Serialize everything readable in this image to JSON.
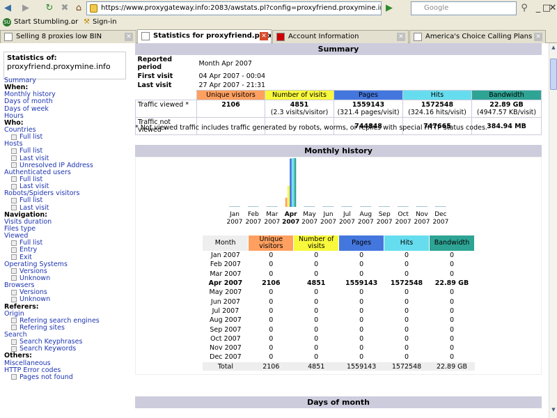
{
  "browser": {
    "url": "https://www.proxygateway.info:2083/awstats.pl?config=proxyfriend.proxymine.info&lang=en",
    "search_placeholder": "Google",
    "bookmarks": [
      "Start Stumbling...",
      "or",
      "Sign-in"
    ],
    "tabs": [
      "Selling 8 proxies low BIN",
      "Statistics for proxyfriend.proxy...",
      "Account Information",
      "America's Choice Calling Plans"
    ]
  },
  "sidebar": {
    "title": "Statistics of:",
    "domain": "proxyfriend.proxymine.info",
    "items": [
      {
        "t": "lk",
        "label": "Summary"
      },
      {
        "t": "h",
        "label": "When:"
      },
      {
        "t": "lk",
        "label": "Monthly history"
      },
      {
        "t": "lk",
        "label": "Days of month"
      },
      {
        "t": "lk",
        "label": "Days of week"
      },
      {
        "t": "lk",
        "label": "Hours"
      },
      {
        "t": "h",
        "label": "Who:"
      },
      {
        "t": "lk",
        "label": "Countries"
      },
      {
        "t": "sub",
        "label": "Full list"
      },
      {
        "t": "lk",
        "label": "Hosts"
      },
      {
        "t": "sub",
        "label": "Full list"
      },
      {
        "t": "sub",
        "label": "Last visit"
      },
      {
        "t": "sub",
        "label": "Unresolved IP Address"
      },
      {
        "t": "lk",
        "label": "Authenticated users"
      },
      {
        "t": "sub",
        "label": "Full list"
      },
      {
        "t": "sub",
        "label": "Last visit"
      },
      {
        "t": "lk",
        "label": "Robots/Spiders visitors"
      },
      {
        "t": "sub",
        "label": "Full list"
      },
      {
        "t": "sub",
        "label": "Last visit"
      },
      {
        "t": "h",
        "label": "Navigation:"
      },
      {
        "t": "lk",
        "label": "Visits duration"
      },
      {
        "t": "lk",
        "label": "Files type"
      },
      {
        "t": "lk",
        "label": "Viewed"
      },
      {
        "t": "sub",
        "label": "Full list"
      },
      {
        "t": "sub",
        "label": "Entry"
      },
      {
        "t": "sub",
        "label": "Exit"
      },
      {
        "t": "lk",
        "label": "Operating Systems"
      },
      {
        "t": "sub",
        "label": "Versions"
      },
      {
        "t": "sub",
        "label": "Unknown"
      },
      {
        "t": "lk",
        "label": "Browsers"
      },
      {
        "t": "sub",
        "label": "Versions"
      },
      {
        "t": "sub",
        "label": "Unknown"
      },
      {
        "t": "h",
        "label": "Referers:"
      },
      {
        "t": "lk",
        "label": "Origin"
      },
      {
        "t": "sub",
        "label": "Refering search engines"
      },
      {
        "t": "sub",
        "label": "Refering sites"
      },
      {
        "t": "lk",
        "label": "Search"
      },
      {
        "t": "sub",
        "label": "Search Keyphrases"
      },
      {
        "t": "sub",
        "label": "Search Keywords"
      },
      {
        "t": "h",
        "label": "Others:"
      },
      {
        "t": "lk",
        "label": "Miscellaneous"
      },
      {
        "t": "lk",
        "label": "HTTP Error codes"
      },
      {
        "t": "sub",
        "label": "Pages not found"
      }
    ]
  },
  "summary": {
    "title": "Summary",
    "reported_period_label": "Reported period",
    "reported_period": "Month Apr 2007",
    "first_visit_label": "First visit",
    "first_visit": "04 Apr 2007 - 00:04",
    "last_visit_label": "Last visit",
    "last_visit": "27 Apr 2007 - 21:31",
    "headers": [
      "Unique visitors",
      "Number of visits",
      "Pages",
      "Hits",
      "Bandwidth"
    ],
    "viewed_label": "Traffic viewed *",
    "viewed": [
      "2106",
      "4851",
      "1559143",
      "1572548",
      "22.89 GB"
    ],
    "viewed_sub": [
      "",
      "(2.3 visits/visitor)",
      "(321.4 pages/visit)",
      "(324.16 hits/visit)",
      "(4947.57 KB/visit)"
    ],
    "not_viewed_label": "Traffic not viewed *",
    "not_viewed": [
      "",
      "",
      "744848",
      "747665",
      "384.94 MB"
    ],
    "note": "* Not viewed traffic includes traffic generated by robots, worms, or replies with special HTTP status codes."
  },
  "monthly": {
    "title": "Monthly history",
    "headers": [
      "Month",
      "Unique visitors",
      "Number of visits",
      "Pages",
      "Hits",
      "Bandwidth"
    ],
    "rows": [
      [
        "Jan 2007",
        "0",
        "0",
        "0",
        "0",
        "0"
      ],
      [
        "Feb 2007",
        "0",
        "0",
        "0",
        "0",
        "0"
      ],
      [
        "Mar 2007",
        "0",
        "0",
        "0",
        "0",
        "0"
      ],
      [
        "Apr 2007",
        "2106",
        "4851",
        "1559143",
        "1572548",
        "22.89 GB"
      ],
      [
        "May 2007",
        "0",
        "0",
        "0",
        "0",
        "0"
      ],
      [
        "Jun 2007",
        "0",
        "0",
        "0",
        "0",
        "0"
      ],
      [
        "Jul 2007",
        "0",
        "0",
        "0",
        "0",
        "0"
      ],
      [
        "Aug 2007",
        "0",
        "0",
        "0",
        "0",
        "0"
      ],
      [
        "Sep 2007",
        "0",
        "0",
        "0",
        "0",
        "0"
      ],
      [
        "Oct 2007",
        "0",
        "0",
        "0",
        "0",
        "0"
      ],
      [
        "Nov 2007",
        "0",
        "0",
        "0",
        "0",
        "0"
      ],
      [
        "Dec 2007",
        "0",
        "0",
        "0",
        "0",
        "0"
      ]
    ],
    "total": [
      "Total",
      "2106",
      "4851",
      "1559143",
      "1572548",
      "22.89 GB"
    ]
  },
  "chart_data": {
    "type": "bar",
    "categories": [
      "Jan 2007",
      "Feb 2007",
      "Mar 2007",
      "Apr 2007",
      "May 2007",
      "Jun 2007",
      "Jul 2007",
      "Aug 2007",
      "Sep 2007",
      "Oct 2007",
      "Nov 2007",
      "Dec 2007"
    ],
    "month_labels": [
      "Jan",
      "Feb",
      "Mar",
      "Apr",
      "May",
      "Jun",
      "Jul",
      "Aug",
      "Sep",
      "Oct",
      "Nov",
      "Dec"
    ],
    "year_label": "2007",
    "highlight": "Apr",
    "series": [
      {
        "name": "Unique visitors",
        "values": [
          0,
          0,
          0,
          2106,
          0,
          0,
          0,
          0,
          0,
          0,
          0,
          0
        ],
        "color": "#ffa060"
      },
      {
        "name": "Number of visits",
        "values": [
          0,
          0,
          0,
          4851,
          0,
          0,
          0,
          0,
          0,
          0,
          0,
          0
        ],
        "color": "#f8f83c"
      },
      {
        "name": "Pages",
        "values": [
          0,
          0,
          0,
          1559143,
          0,
          0,
          0,
          0,
          0,
          0,
          0,
          0
        ],
        "color": "#4477dd"
      },
      {
        "name": "Hits",
        "values": [
          0,
          0,
          0,
          1572548,
          0,
          0,
          0,
          0,
          0,
          0,
          0,
          0
        ],
        "color": "#66ddee"
      },
      {
        "name": "Bandwidth",
        "values": [
          0,
          0,
          0,
          22.89,
          0,
          0,
          0,
          0,
          0,
          0,
          0,
          0
        ],
        "color": "#2ea495"
      }
    ]
  },
  "days_title": "Days of month"
}
